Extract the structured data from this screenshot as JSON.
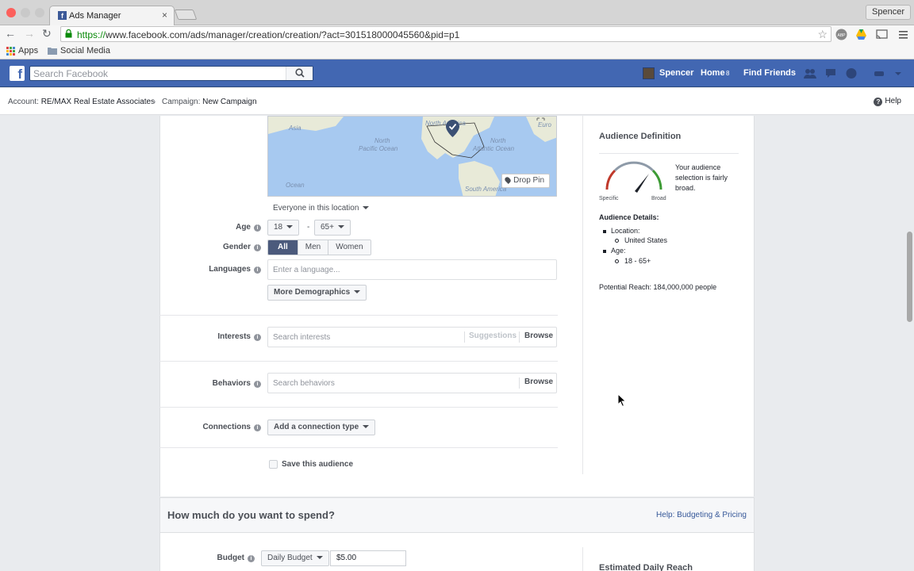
{
  "browser": {
    "tab_title": "Ads Manager",
    "tab_favicon": "f",
    "profile": "Spencer",
    "url_scheme": "https://",
    "url_rest": "www.facebook.com/ads/manager/creation/creation/?act=301518000045560&pid=p1",
    "bookmarks": [
      "Apps",
      "Social Media"
    ]
  },
  "fb": {
    "logo": "f",
    "search_placeholder": "Search Facebook",
    "user_name": "Spencer",
    "home": "Home",
    "home_badge": "8",
    "find_friends": "Find Friends"
  },
  "breadcrumb": {
    "account_label": "Account:",
    "account_value": "RE/MAX Real Estate Associates",
    "campaign_label": "Campaign:",
    "campaign_value": "New Campaign",
    "help": "Help"
  },
  "map": {
    "labels": [
      "Asia",
      "North",
      "Pacific Ocean",
      "North America",
      "North",
      "Atlantic Ocean",
      "Euro",
      "South America",
      "Ocean"
    ],
    "drop_pin": "Drop Pin"
  },
  "audience": {
    "location_mode": "Everyone in this location",
    "age_label": "Age",
    "age_min": "18",
    "age_max": "65+",
    "age_separator": "-",
    "gender_label": "Gender",
    "genders": [
      "All",
      "Men",
      "Women"
    ],
    "languages_label": "Languages",
    "languages_placeholder": "Enter a language...",
    "more_demographics": "More Demographics",
    "interests_label": "Interests",
    "interests_placeholder": "Search interests",
    "suggestions": "Suggestions",
    "browse": "Browse",
    "behaviors_label": "Behaviors",
    "behaviors_placeholder": "Search behaviors",
    "connections_label": "Connections",
    "connections_dropdown": "Add a connection type",
    "save_audience": "Save this audience",
    "help_glyph": "i"
  },
  "definition": {
    "title": "Audience Definition",
    "gauge_left": "Specific",
    "gauge_right": "Broad",
    "description": "Your audience selection is fairly broad.",
    "details_title": "Audience Details:",
    "location_key": "Location:",
    "location_value": "United States",
    "age_key": "Age:",
    "age_value": "18 - 65+",
    "potential_reach": "Potential Reach: 184,000,000 people"
  },
  "spend": {
    "title": "How much do you want to spend?",
    "help_link": "Help: Budgeting & Pricing",
    "budget_label": "Budget",
    "budget_type": "Daily Budget",
    "budget_value": "$5.00",
    "estimated_title": "Estimated Daily Reach"
  }
}
